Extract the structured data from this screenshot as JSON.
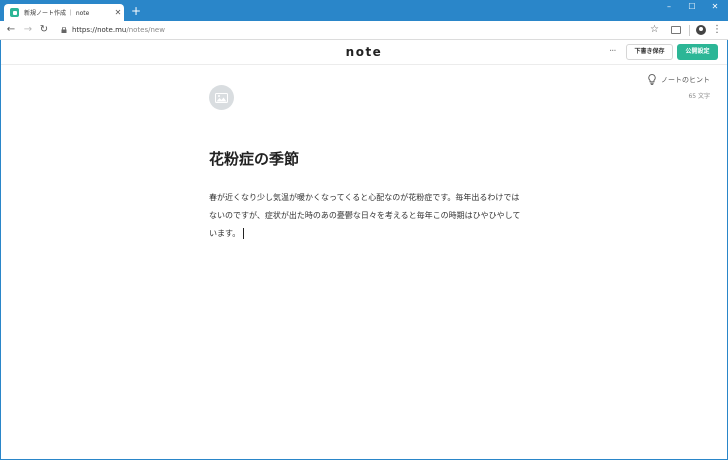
{
  "browser": {
    "tab_title": "新規ノート作成 ｜ note",
    "tab_close": "✕",
    "new_tab": "+",
    "window_controls": {
      "minimize": "–",
      "maximize": "☐",
      "close": "✕"
    },
    "nav": {
      "back": "←",
      "forward": "→",
      "reload": "↻"
    },
    "url_host": "https://note.mu",
    "url_path": "/notes/new",
    "bookmark": "☆",
    "menu": "⋮"
  },
  "header": {
    "logo": "note",
    "more": "···",
    "draft_button": "下書き保存",
    "publish_button": "公開設定"
  },
  "sidebar": {
    "hint_label": "ノートのヒント",
    "char_count": "65 文字"
  },
  "editor": {
    "title": "花粉症の季節",
    "body": "春が近くなり少し気温が暖かくなってくると心配なのが花粉症です。毎年出るわけではないのですが、症状が出た時のあの憂鬱な日々を考えると毎年この時期はひやひやしています。"
  },
  "colors": {
    "titlebar": "#2a86c9",
    "accent": "#2cb696",
    "image_placeholder": "#d9dde0"
  },
  "icons": {
    "favicon": "note-favicon-icon",
    "lock": "lock-icon",
    "bookmark": "star-icon",
    "extension": "extension-icon",
    "account": "account-icon",
    "image": "image-icon",
    "hint": "lightbulb-icon"
  }
}
